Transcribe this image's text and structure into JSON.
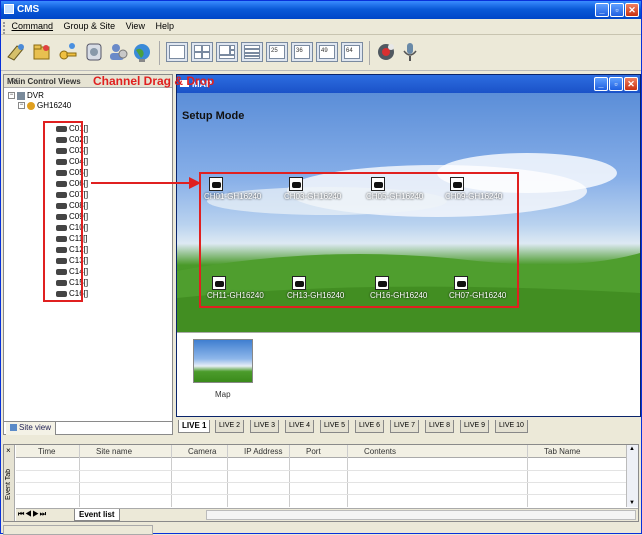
{
  "app": {
    "title": "CMS"
  },
  "menu": [
    "Command",
    "Group & Site",
    "View",
    "Help"
  ],
  "toolbar": {
    "icons": [
      "connect-icon",
      "group-icon",
      "key-icon",
      "settings-icon",
      "user-icon",
      "globe-icon",
      "record-icon",
      "microphone-icon"
    ],
    "layouts": [
      "layout-1x1",
      "layout-2x2",
      "layout-3x3",
      "layout-4x4",
      "layout-1+5",
      "layout-8",
      "layout-13",
      "layout-16"
    ],
    "layout_badges": [
      "",
      "",
      "",
      "",
      "25",
      "36",
      "49",
      "64"
    ]
  },
  "left_panel": {
    "title": "Main Control Views",
    "tree": {
      "root": "DVR",
      "device": "GH16240",
      "channels": [
        "C01[]",
        "C02[]",
        "C03[]",
        "C04[]",
        "C05[]",
        "C06[]",
        "C07[]",
        "C08[]",
        "C09[]",
        "C10[]",
        "C11[]",
        "C12[]",
        "C13[]",
        "C14[]",
        "C15[]",
        "C16[]"
      ]
    },
    "tab": "Site view"
  },
  "annotation": {
    "label": "Channel Drag & Drop"
  },
  "map_window": {
    "title": "MAP",
    "mode_label": "Setup Mode",
    "cameras_top": [
      "CH01-GH16240",
      "CH03-GH16240",
      "CH05-GH16240",
      "CH09-GH16240"
    ],
    "cameras_bottom": [
      "CH11-GH16240",
      "CH13-GH16240",
      "CH16-GH16240",
      "CH07-GH16240"
    ],
    "map_thumb_label": "Map"
  },
  "live_tabs": [
    "LIVE 1",
    "LIVE 2",
    "LIVE 3",
    "LIVE 4",
    "LIVE 5",
    "LIVE 6",
    "LIVE 7",
    "LIVE 8",
    "LIVE 9",
    "LIVE 10"
  ],
  "event_panel": {
    "columns": [
      "Time",
      "Site name",
      "Camera",
      "IP Address",
      "Port",
      "Contents",
      "Tab Name"
    ],
    "side_label": "Event Tab",
    "tab": "Event list"
  },
  "colors": {
    "accent": "#e02020",
    "title_blue": "#0a5ad8"
  }
}
